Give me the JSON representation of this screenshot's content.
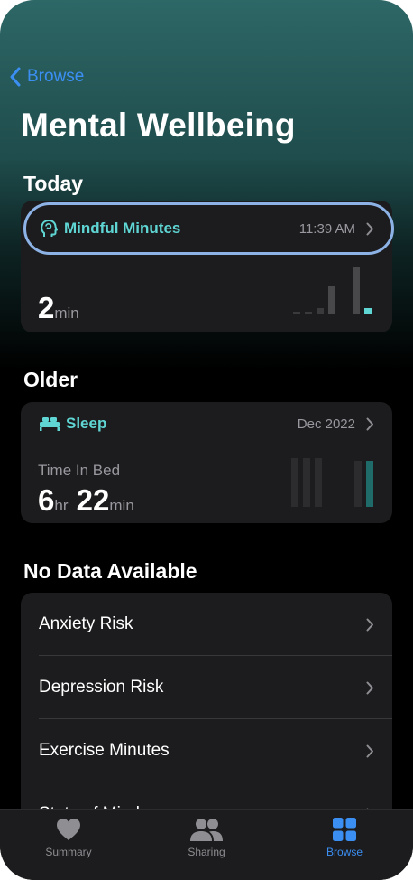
{
  "nav": {
    "back_label": "Browse"
  },
  "page": {
    "title": "Mental Wellbeing"
  },
  "sections": {
    "today": "Today",
    "older": "Older",
    "no_data": "No Data Available"
  },
  "mindful": {
    "label": "Mindful Minutes",
    "time": "11:39 AM",
    "value": "2",
    "unit": "min",
    "icon": "head-brain-icon"
  },
  "sleep": {
    "label": "Sleep",
    "date": "Dec 2022",
    "metric": "Time In Bed",
    "hours": "6",
    "hours_unit": "hr",
    "minutes": "22",
    "minutes_unit": "min",
    "icon": "bed-icon"
  },
  "no_data_items": [
    "Anxiety Risk",
    "Depression Risk",
    "Exercise Minutes",
    "State of Mind"
  ],
  "tabbar": {
    "summary": "Summary",
    "sharing": "Sharing",
    "browse": "Browse"
  },
  "colors": {
    "accent": "#3b8ff3",
    "teal": "#5fd6d4"
  }
}
